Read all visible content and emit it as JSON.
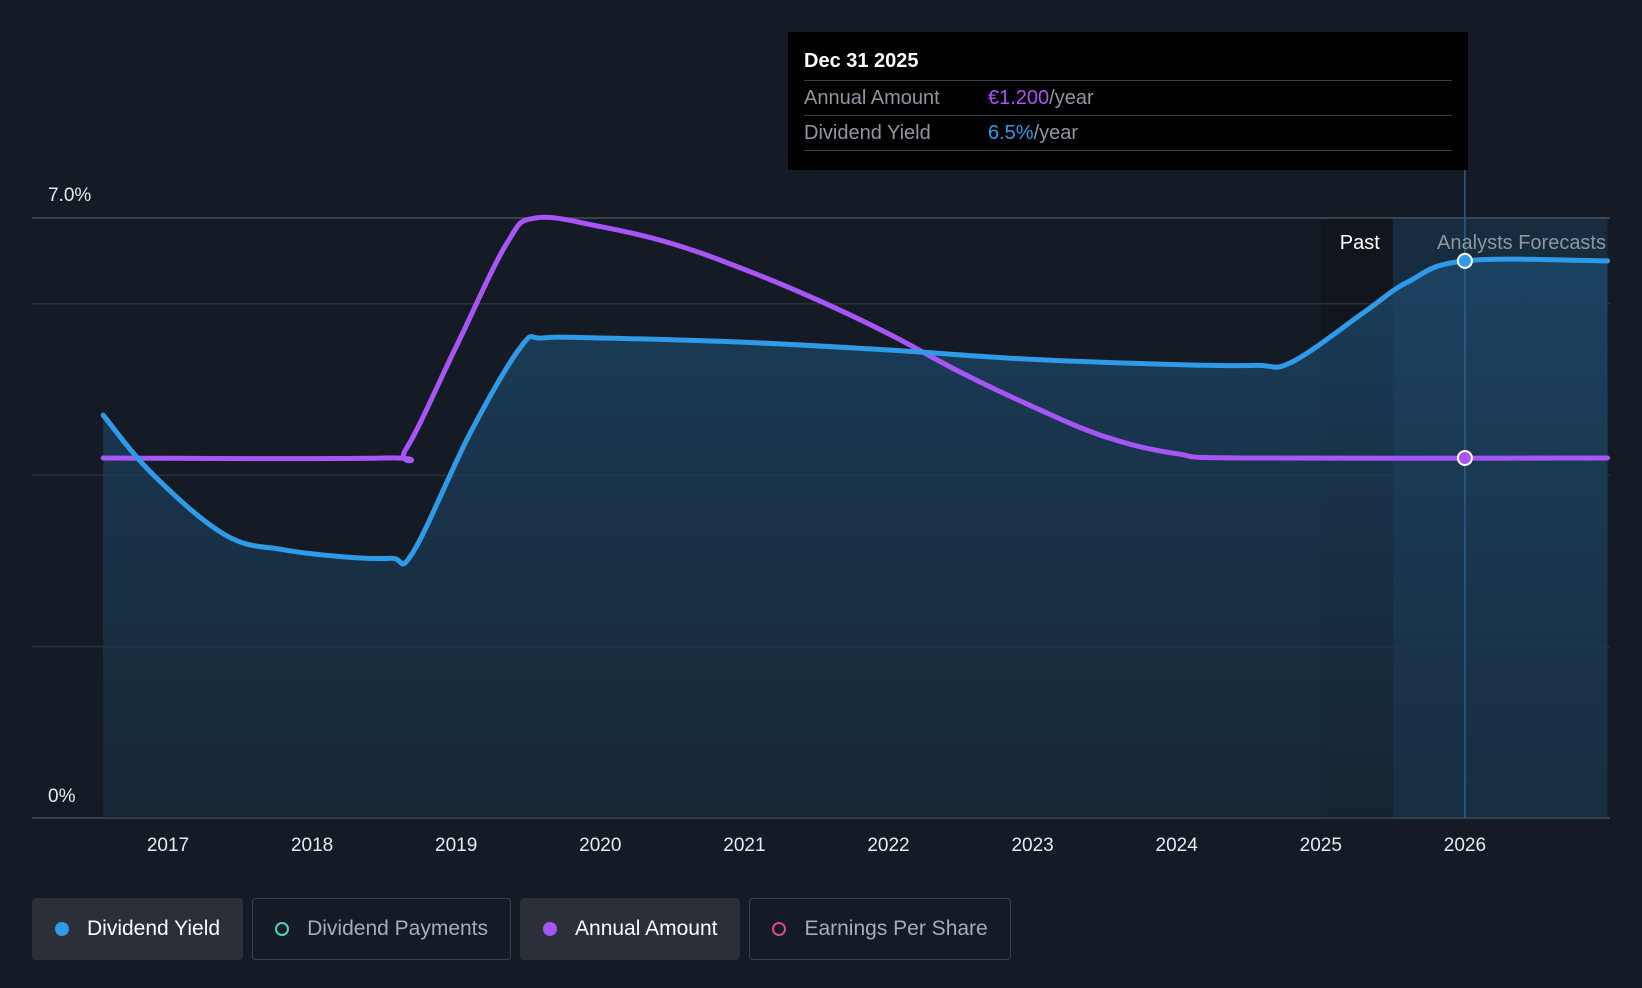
{
  "tooltip": {
    "date": "Dec 31 2025",
    "rows": [
      {
        "label": "Annual Amount",
        "value": "€1.200",
        "suffix": "/year"
      },
      {
        "label": "Dividend Yield",
        "value": "6.5%",
        "suffix": "/year"
      }
    ]
  },
  "regions": {
    "past": "Past",
    "forecast": "Analysts Forecasts"
  },
  "legend": [
    {
      "label": "Dividend Yield",
      "color": "#2f9ae8",
      "active": true,
      "filled": true
    },
    {
      "label": "Dividend Payments",
      "color": "#4fd1c5",
      "active": false,
      "filled": false
    },
    {
      "label": "Annual Amount",
      "color": "#a855f7",
      "active": true,
      "filled": true
    },
    {
      "label": "Earnings Per Share",
      "color": "#d94a8c",
      "active": false,
      "filled": false
    }
  ],
  "colors": {
    "yield": "#2f9ae8",
    "amount": "#a855f7",
    "background": "#151b24"
  },
  "chart_data": {
    "type": "line",
    "y_tick_labels": [
      "7.0%",
      "0%"
    ],
    "ylim": [
      0,
      7.0
    ],
    "xlim": [
      2016.55,
      2026.99
    ],
    "x_tick_labels": [
      "2017",
      "2018",
      "2019",
      "2020",
      "2021",
      "2022",
      "2023",
      "2024",
      "2025",
      "2026"
    ],
    "x_ticks": [
      2017,
      2018,
      2019,
      2020,
      2021,
      2022,
      2023,
      2024,
      2025,
      2026
    ],
    "grid": true,
    "past_end": 2025.0,
    "forecast_start": 2025.5,
    "highlight_x": 2026.0,
    "series": [
      {
        "name": "Dividend Yield",
        "unit": "%",
        "points": [
          [
            2016.55,
            4.7
          ],
          [
            2016.9,
            4.0
          ],
          [
            2017.4,
            3.3
          ],
          [
            2017.8,
            3.13
          ],
          [
            2018.2,
            3.05
          ],
          [
            2018.55,
            3.03
          ],
          [
            2018.7,
            3.1
          ],
          [
            2019.1,
            4.5
          ],
          [
            2019.45,
            5.5
          ],
          [
            2019.6,
            5.6
          ],
          [
            2020.0,
            5.6
          ],
          [
            2021.0,
            5.55
          ],
          [
            2022.0,
            5.46
          ],
          [
            2023.0,
            5.35
          ],
          [
            2024.0,
            5.29
          ],
          [
            2024.55,
            5.28
          ],
          [
            2024.8,
            5.32
          ],
          [
            2025.3,
            5.9
          ],
          [
            2025.6,
            6.25
          ],
          [
            2026.0,
            6.5
          ],
          [
            2026.99,
            6.5
          ]
        ]
      },
      {
        "name": "Annual Amount",
        "unit": "€",
        "points": [
          [
            2016.55,
            4.2
          ],
          [
            2018.5,
            4.2
          ],
          [
            2018.65,
            4.3
          ],
          [
            2019.0,
            5.5
          ],
          [
            2019.35,
            6.7
          ],
          [
            2019.55,
            7.0
          ],
          [
            2020.0,
            6.9
          ],
          [
            2020.5,
            6.7
          ],
          [
            2021.0,
            6.4
          ],
          [
            2021.5,
            6.05
          ],
          [
            2022.0,
            5.65
          ],
          [
            2022.5,
            5.2
          ],
          [
            2023.0,
            4.8
          ],
          [
            2023.5,
            4.45
          ],
          [
            2024.0,
            4.25
          ],
          [
            2024.5,
            4.2
          ],
          [
            2026.99,
            4.2
          ]
        ]
      }
    ]
  }
}
